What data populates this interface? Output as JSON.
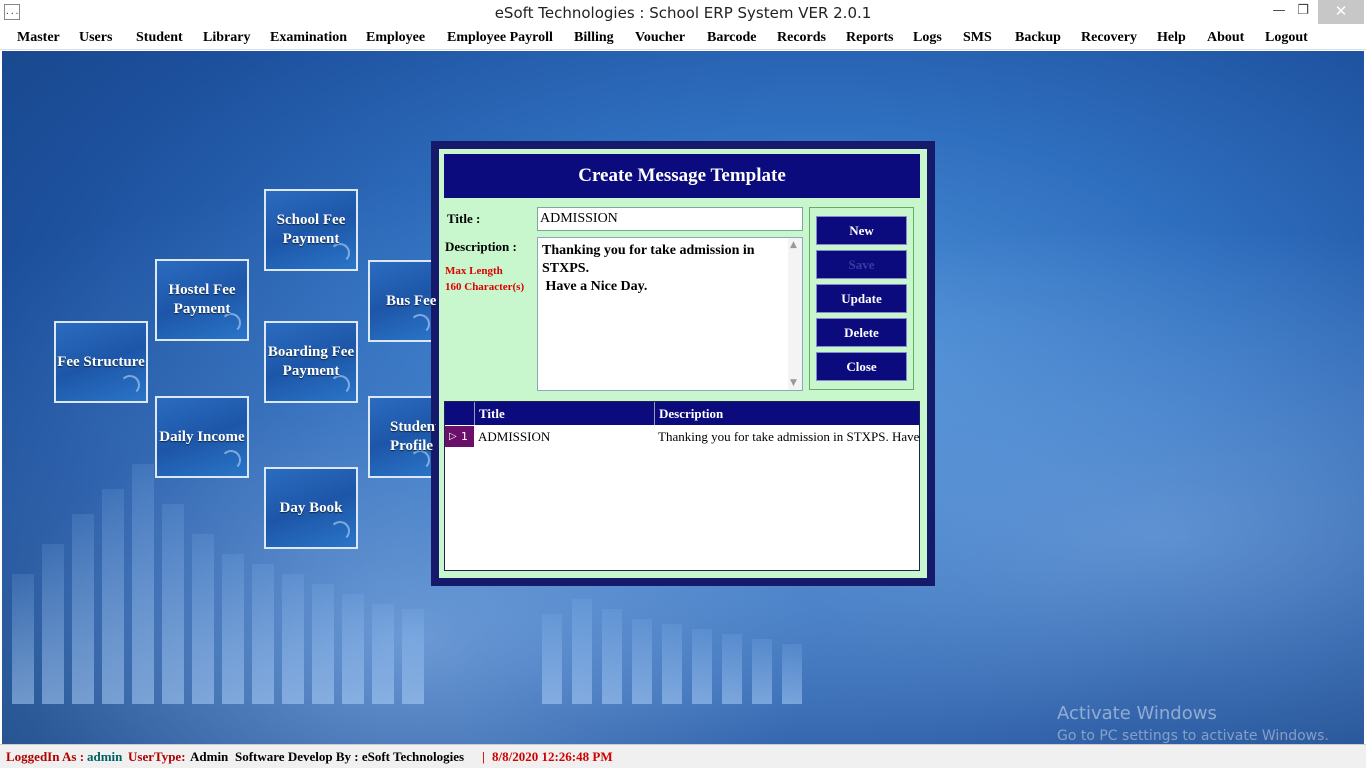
{
  "window": {
    "title": "eSoft Technologies : School ERP System VER 2.0.1",
    "app_icon": "...",
    "min_glyph": "—",
    "max_glyph": "❐",
    "close_glyph": "✕"
  },
  "menu": [
    "Master",
    "Users",
    "Student",
    "Library",
    "Examination",
    "Employee",
    "Employee Payroll",
    "Billing",
    "Voucher",
    "Barcode",
    "Records",
    "Reports",
    "Logs",
    "SMS",
    "Backup",
    "Recovery",
    "Help",
    "About",
    "Logout"
  ],
  "tiles": {
    "school_fee": "School Fee Payment",
    "hostel_fee": "Hostel Fee Payment",
    "bus_fee": "Bus Fee Payment",
    "fee_structure": "Fee Structure",
    "boarding_fee": "Boarding Fee Payment",
    "daily_income": "Daily Income",
    "student_profile": "Student Profile",
    "day_book": "Day Book"
  },
  "watermark": {
    "line1": "Activate Windows",
    "line2": "Go to PC settings to activate Windows."
  },
  "dialog": {
    "title": "Create Message Template",
    "title_label": "Title :",
    "title_value": "ADMISSION",
    "description_label": "Description :",
    "max_length_line1": "Max Length",
    "max_length_line2": "160 Character(s)",
    "description_value": "Thanking you for take admission in STXPS.\n Have a Nice Day.",
    "buttons": {
      "new": "New",
      "save": "Save",
      "update": "Update",
      "delete": "Delete",
      "close": "Close"
    },
    "grid": {
      "columns": [
        "Title",
        "Description"
      ],
      "rows": [
        {
          "index": "1",
          "title": "ADMISSION",
          "description": "Thanking you for take admission in STXPS. Have a Nice Day."
        }
      ]
    }
  },
  "status": {
    "logged_in_label": "LoggedIn As :",
    "logged_in_value": "admin",
    "user_type_label": "UserType:",
    "user_type_value": "Admin",
    "developer": "Software Develop By : eSoft Technologies",
    "separator": "|",
    "datetime": "8/8/2020 12:26:48 PM"
  },
  "colors": {
    "dialog_border": "#151a6b",
    "dialog_bg": "#c9f7cd",
    "header_bg": "#0b0b7d",
    "row_header": "#6a0f6a",
    "status_label": "#b00000",
    "status_value": "#006060",
    "datetime": "#d00000"
  }
}
